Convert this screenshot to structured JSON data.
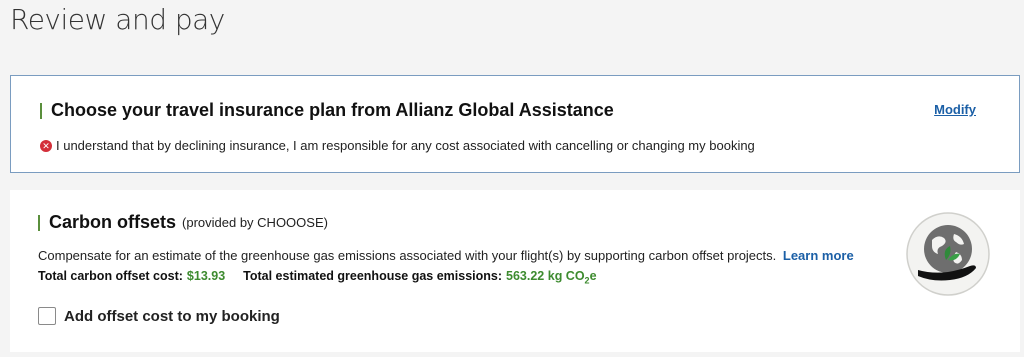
{
  "page": {
    "title": "Review and pay"
  },
  "insurance": {
    "title": "Choose your travel insurance plan from Allianz Global Assistance",
    "modify_label": "Modify",
    "decline_text": "I understand that by declining insurance, I am responsible for any cost associated with cancelling or changing my booking"
  },
  "carbon": {
    "title": "Carbon offsets",
    "provider_note": "(provided by CHOOOSE)",
    "description": "Compensate for an estimate of the greenhouse gas emissions associated with your flight(s) by supporting carbon offset projects.",
    "learn_more_label": "Learn more",
    "total_cost_label": "Total carbon offset cost:",
    "total_cost_value": "$13.93",
    "emissions_label": "Total estimated greenhouse gas emissions:",
    "emissions_value": "563.22 kg CO",
    "emissions_sub": "2",
    "emissions_suffix": "e",
    "checkbox_label": "Add offset cost to my booking",
    "checkbox_checked": false
  },
  "icons": {
    "error": "error-circle-icon",
    "globe": "globe-hand-icon"
  },
  "colors": {
    "accent_green": "#5a8f3c",
    "value_green": "#3d8b2f",
    "link_blue": "#1b5fa6",
    "error_red": "#d32f3a",
    "card_border": "#7a9cc0"
  }
}
